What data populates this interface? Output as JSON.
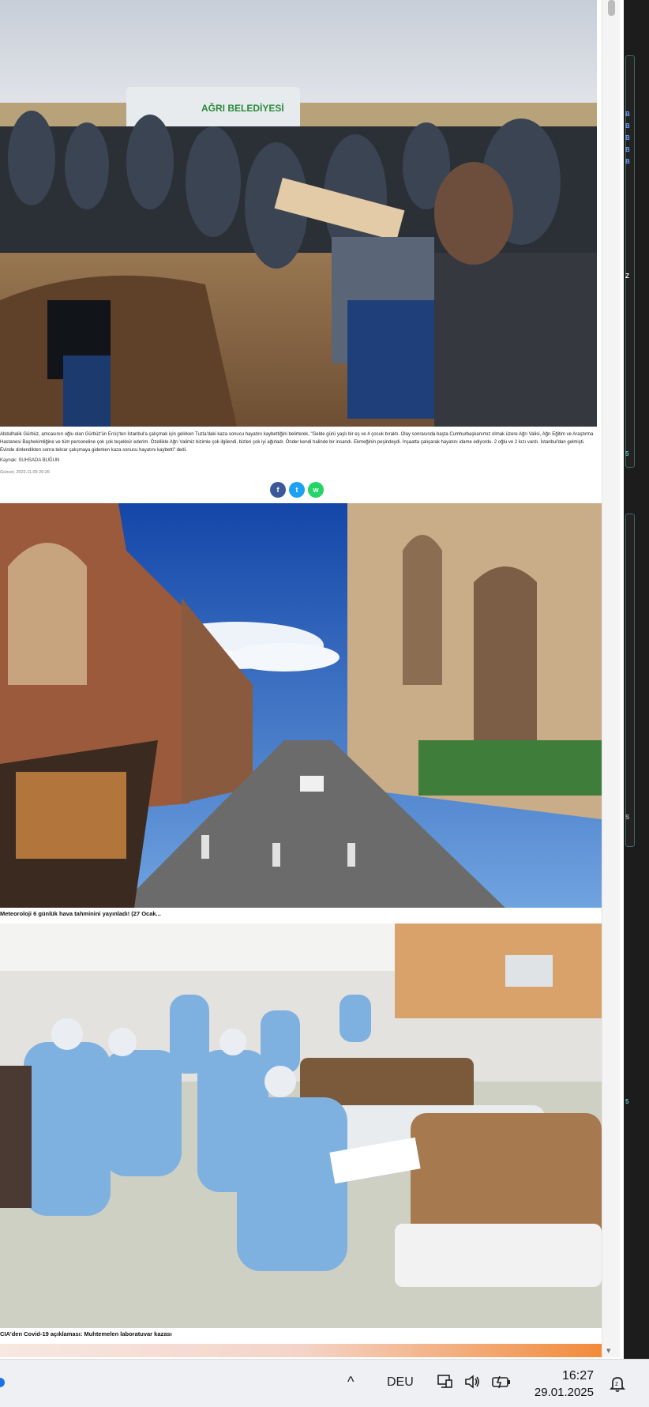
{
  "article1": {
    "body": "Abdulhalik Gürbüz, amcasının oğlu olan Gürbüz'ün Erciş'ten İstanbul'a çalışmak için gelirken Tuzla'daki kaza sonucu hayatını kaybettiğini belirterek, \"Gelde gürü yaşlı bir eş ve 4 çocuk bıraktı. Olay sonrasında başta Cumhurbaşkanımız olmak üzere Ağrı Valisi, Ağrı Eğitim ve Araştırma Hastanesi Başhekimliğine ve tüm personeline çok çok teşekkür ederim. Özellikle Ağrı Valimiz bizimle çok ilgilendi, bizleri çok iyi ağırladı. Önder kendi halinde bir insandı. Ekmeğinin peşindeydi. İnşaatta çalışarak hayatını idame ediyordu. 2 oğlu ve 2 kızı vardı. İstanbul'dan gelmişti. Evinde dinlendikten sonra tekrar çalışmaya giderken kaza sonucu hayatını kaybetti\" dedi.",
    "source": "Kaynak: SUHSADA BUĞUN",
    "date": "Güncel, 2022.11.09 20:26",
    "vehicle_text": "AĞRI BELEDİYESİ"
  },
  "share": {
    "facebook": "f",
    "twitter": "t",
    "whatsapp": "w",
    "colors": {
      "facebook": "#3b5998",
      "twitter": "#1da1f2",
      "whatsapp": "#25d366"
    }
  },
  "article2": {
    "headline": "Meteoroloji 6 günlük hava tahminini yayınladı! (27 Ocak..."
  },
  "article3": {
    "headline": "CIA'den Covid-19 açıklaması: Muhtemelen laboratuvar kazası"
  },
  "scrollbar": {
    "down_icon": "▾"
  },
  "right_strip": {
    "letters_top": [
      "B",
      "B",
      "B",
      "B",
      "B"
    ],
    "letters_mid": [
      "Z"
    ],
    "letters_bottom": [
      "S"
    ],
    "numbers": [
      "5",
      "5"
    ]
  },
  "taskbar": {
    "chevron": "^",
    "language": "DEU",
    "time": "16:27",
    "date": "29.01.2025"
  }
}
